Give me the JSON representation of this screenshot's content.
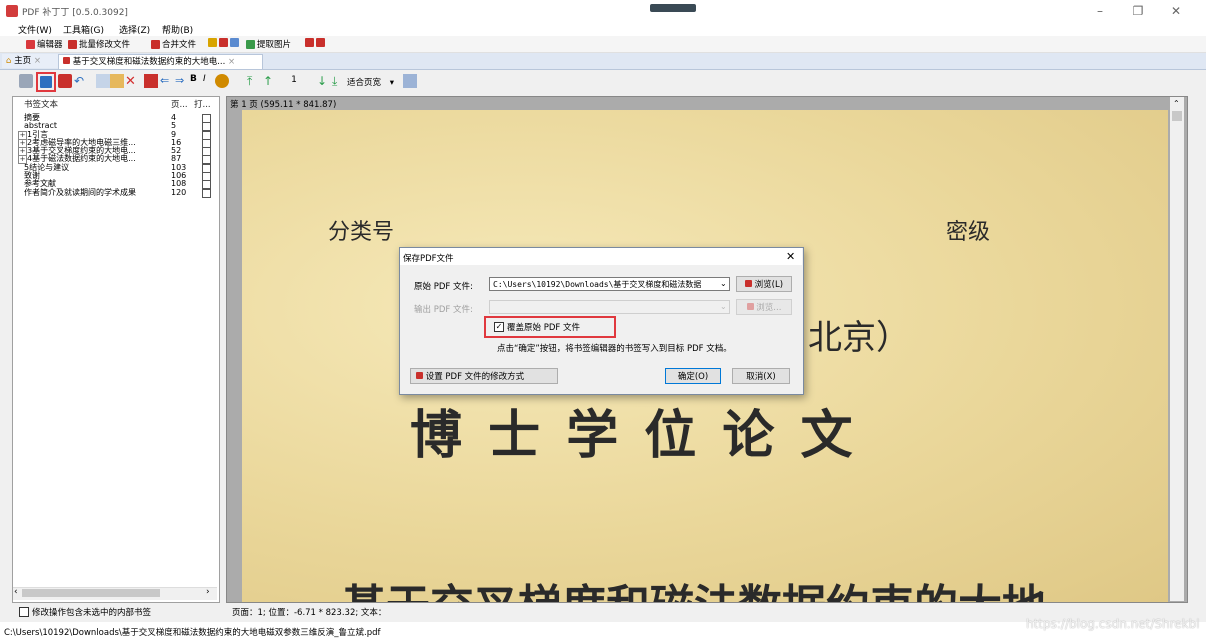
{
  "app": {
    "title": "PDF 补丁丁 [0.5.0.3092]"
  },
  "menu": {
    "items": [
      "文件(W)",
      "工具箱(G)",
      "选择(Z)",
      "帮助(B)"
    ]
  },
  "toolbar1": {
    "items": [
      "编辑器",
      "批量修改文件",
      "合并文件",
      "提取图片"
    ]
  },
  "tabs": {
    "home": "主页",
    "doc": "基于交叉梯度和磁法数据约束的大地电..."
  },
  "toolbar2": {
    "page_number": "1",
    "zoom": "适合页宽"
  },
  "bookmarks": {
    "col_text": "书签文本",
    "col_page": "页...",
    "col_open": "打...",
    "rows": [
      {
        "label": "摘要",
        "page": "4",
        "expandable": false
      },
      {
        "label": "abstract",
        "page": "5",
        "expandable": false
      },
      {
        "label": "1引言",
        "page": "9",
        "expandable": true
      },
      {
        "label": "2考虑磁导率的大地电磁三维...",
        "page": "16",
        "expandable": true
      },
      {
        "label": "3基于交叉梯度约束的大地电...",
        "page": "52",
        "expandable": true
      },
      {
        "label": "4基于磁法数据约束的大地电...",
        "page": "87",
        "expandable": true
      },
      {
        "label": "5结论与建议",
        "page": "103",
        "expandable": false
      },
      {
        "label": "致谢",
        "page": "106",
        "expandable": false
      },
      {
        "label": "参考文献",
        "page": "108",
        "expandable": false
      },
      {
        "label": "作者简介及就读期间的学术成果",
        "page": "120",
        "expandable": false
      }
    ]
  },
  "document": {
    "page_info": "第 1 页 (595.11 * 841.87)",
    "class_number": "分类号",
    "secret_level": "密级",
    "location": "北京）",
    "degree_title": "博 士 学 位 论 文",
    "thesis_title": "基于交叉梯度和磁法数据约束的大地"
  },
  "dialog": {
    "title": "保存PDF文件",
    "source_label": "原始 PDF 文件:",
    "source_value": "C:\\Users\\10192\\Downloads\\基于交叉梯度和磁法数据",
    "browse_label": "浏览(L)",
    "output_label": "输出 PDF 文件:",
    "output_browse_label": "浏览...",
    "overwrite_label": "覆盖原始 PDF 文件",
    "overwrite_checked": true,
    "hint": "点击“确定”按钮，将书签编辑器的书签写入到目标 PDF 文档。",
    "settings_label": "设置 PDF 文件的修改方式",
    "ok_label": "确定(O)",
    "cancel_label": "取消(X)"
  },
  "status": {
    "include_hidden_label": "修改操作包含未选中的内部书签",
    "position_info": "页面：1; 位置：-6.71 * 823.32; 文本：",
    "file_path": "C:\\Users\\10192\\Downloads\\基于交叉梯度和磁法数据约束的大地电磁双参数三维反演_鲁立斌.pdf",
    "watermark": "https://blog.csdn.net/Shrekbl"
  },
  "colors": {
    "accent_red": "#e0383e",
    "paper": "#ead79a",
    "tab_bg": "#dfe7f3"
  }
}
